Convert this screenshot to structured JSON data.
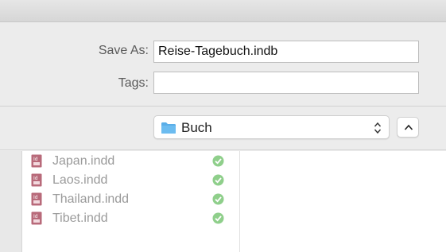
{
  "form": {
    "save_as_label": "Save As:",
    "save_as_value": "Reise-Tagebuch.indb",
    "tags_label": "Tags:",
    "tags_value": ""
  },
  "location": {
    "folder_name": "Buch",
    "folder_icon": "folder-icon",
    "popup_icon": "chevron-updown-icon",
    "collapse_icon": "chevron-up-icon"
  },
  "files": [
    {
      "name": "Japan.indd",
      "icon": "indesign-document-icon",
      "status": "synced-check-icon"
    },
    {
      "name": "Laos.indd",
      "icon": "indesign-document-icon",
      "status": "synced-check-icon"
    },
    {
      "name": "Thailand.indd",
      "icon": "indesign-document-icon",
      "status": "synced-check-icon"
    },
    {
      "name": "Tibet.indd",
      "icon": "indesign-document-icon",
      "status": "synced-check-icon"
    }
  ],
  "colors": {
    "folder_blue": "#5aaee8",
    "check_green": "#8fcf8b",
    "indesign_icon": "#b86a7a"
  }
}
